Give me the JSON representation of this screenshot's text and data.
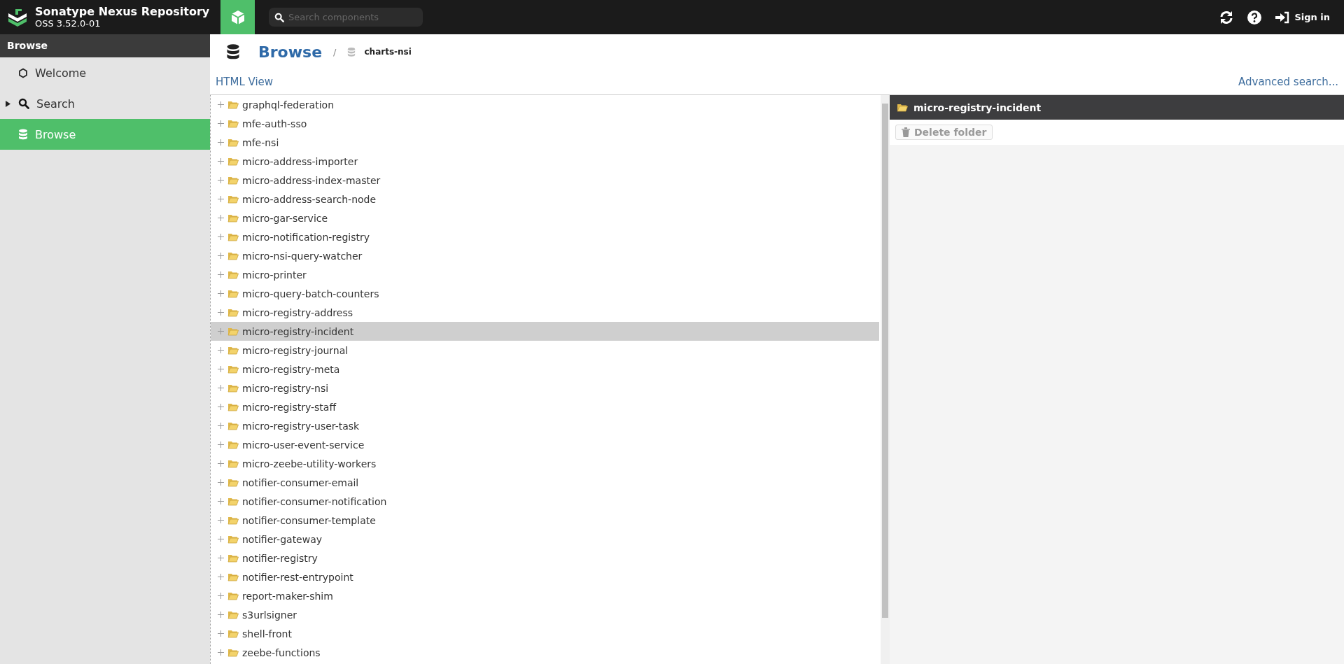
{
  "header": {
    "title": "Sonatype Nexus Repository",
    "version": "OSS 3.52.0-01",
    "search": {
      "placeholder": "Search components"
    },
    "sign_in": "Sign in"
  },
  "sidebar": {
    "title": "Browse",
    "items": [
      {
        "label": "Welcome",
        "selected": false,
        "kind": "welcome"
      },
      {
        "label": "Search",
        "selected": false,
        "kind": "search",
        "expanded": false
      },
      {
        "label": "Browse",
        "selected": true,
        "kind": "browse"
      }
    ]
  },
  "breadcrumb": {
    "title": "Browse",
    "separator": "/",
    "repository": "charts-nsi"
  },
  "html_view": "HTML View",
  "advanced_search": "Advanced search...",
  "tree": {
    "items": [
      {
        "label": "graphql-federation",
        "selected": false
      },
      {
        "label": "mfe-auth-sso",
        "selected": false
      },
      {
        "label": "mfe-nsi",
        "selected": false
      },
      {
        "label": "micro-address-importer",
        "selected": false
      },
      {
        "label": "micro-address-index-master",
        "selected": false
      },
      {
        "label": "micro-address-search-node",
        "selected": false
      },
      {
        "label": "micro-gar-service",
        "selected": false
      },
      {
        "label": "micro-notification-registry",
        "selected": false
      },
      {
        "label": "micro-nsi-query-watcher",
        "selected": false
      },
      {
        "label": "micro-printer",
        "selected": false
      },
      {
        "label": "micro-query-batch-counters",
        "selected": false
      },
      {
        "label": "micro-registry-address",
        "selected": false
      },
      {
        "label": "micro-registry-incident",
        "selected": true
      },
      {
        "label": "micro-registry-journal",
        "selected": false
      },
      {
        "label": "micro-registry-meta",
        "selected": false
      },
      {
        "label": "micro-registry-nsi",
        "selected": false
      },
      {
        "label": "micro-registry-staff",
        "selected": false
      },
      {
        "label": "micro-registry-user-task",
        "selected": false
      },
      {
        "label": "micro-user-event-service",
        "selected": false
      },
      {
        "label": "micro-zeebe-utility-workers",
        "selected": false
      },
      {
        "label": "notifier-consumer-email",
        "selected": false
      },
      {
        "label": "notifier-consumer-notification",
        "selected": false
      },
      {
        "label": "notifier-consumer-template",
        "selected": false
      },
      {
        "label": "notifier-gateway",
        "selected": false
      },
      {
        "label": "notifier-registry",
        "selected": false
      },
      {
        "label": "notifier-rest-entrypoint",
        "selected": false
      },
      {
        "label": "report-maker-shim",
        "selected": false
      },
      {
        "label": "s3urlsigner",
        "selected": false
      },
      {
        "label": "shell-front",
        "selected": false
      },
      {
        "label": "zeebe-functions",
        "selected": false
      }
    ]
  },
  "detail": {
    "title": "micro-registry-incident",
    "delete_button": {
      "label": "Delete folder",
      "disabled": true
    }
  }
}
